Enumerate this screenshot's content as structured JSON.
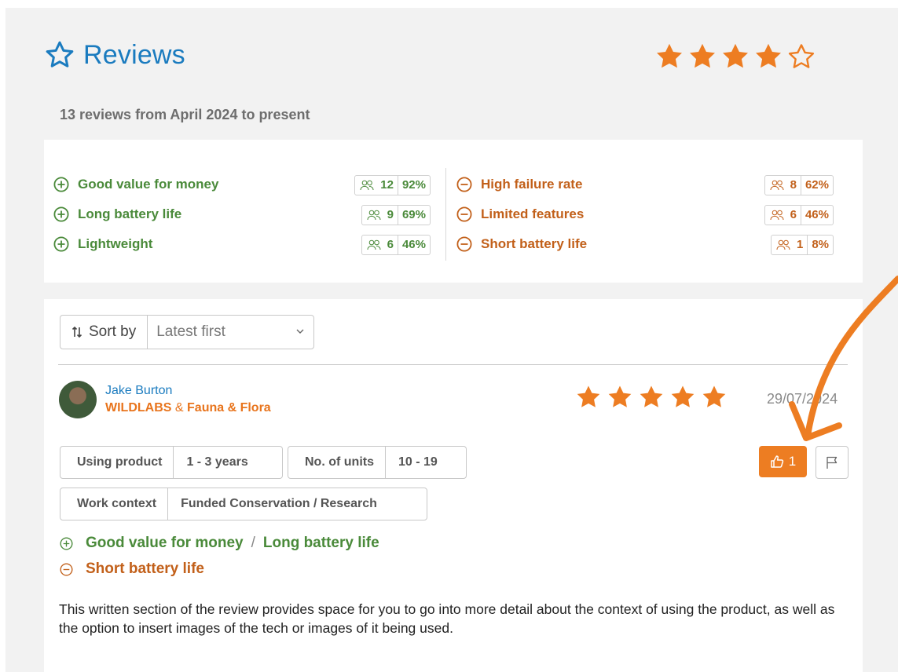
{
  "header": {
    "title": "Reviews",
    "rating_stars": 4,
    "rating_max": 5,
    "subtitle": "13 reviews from April 2024 to present"
  },
  "summary": {
    "pros": [
      {
        "label": "Good value for money",
        "count": "12",
        "percent": "92%"
      },
      {
        "label": "Long battery life",
        "count": "9",
        "percent": "69%"
      },
      {
        "label": "Lightweight",
        "count": "6",
        "percent": "46%"
      }
    ],
    "cons": [
      {
        "label": "High failure rate",
        "count": "8",
        "percent": "62%"
      },
      {
        "label": "Limited features",
        "count": "6",
        "percent": "46%"
      },
      {
        "label": "Short battery life",
        "count": "1",
        "percent": "8%"
      }
    ]
  },
  "sort": {
    "label": "Sort by",
    "selected": "Latest first"
  },
  "review": {
    "reviewer_name": "Jake Burton",
    "org_1": "WILDLABS",
    "org_joiner": "&",
    "org_2": "Fauna & Flora",
    "stars": 5,
    "date": "29/07/2024",
    "tags": [
      {
        "key": "Using product",
        "value": "1 - 3 years"
      },
      {
        "key": "No. of units",
        "value": "10 - 19"
      },
      {
        "key": "Work context",
        "value": "Funded Conservation / Research"
      }
    ],
    "like_count": "1",
    "pros": [
      "Good value for money",
      "Long battery life"
    ],
    "pros_separator": "/",
    "cons": [
      "Short battery life"
    ],
    "body": "This written section of the review provides space for you to go into more detail about the context of using the product, as well as the option to insert images of the tech or images of it being used."
  },
  "colors": {
    "accent_blue": "#1a7bbf",
    "accent_orange": "#ed7d22",
    "pro_green": "#4a8a3a",
    "con_orange": "#c2601a"
  }
}
